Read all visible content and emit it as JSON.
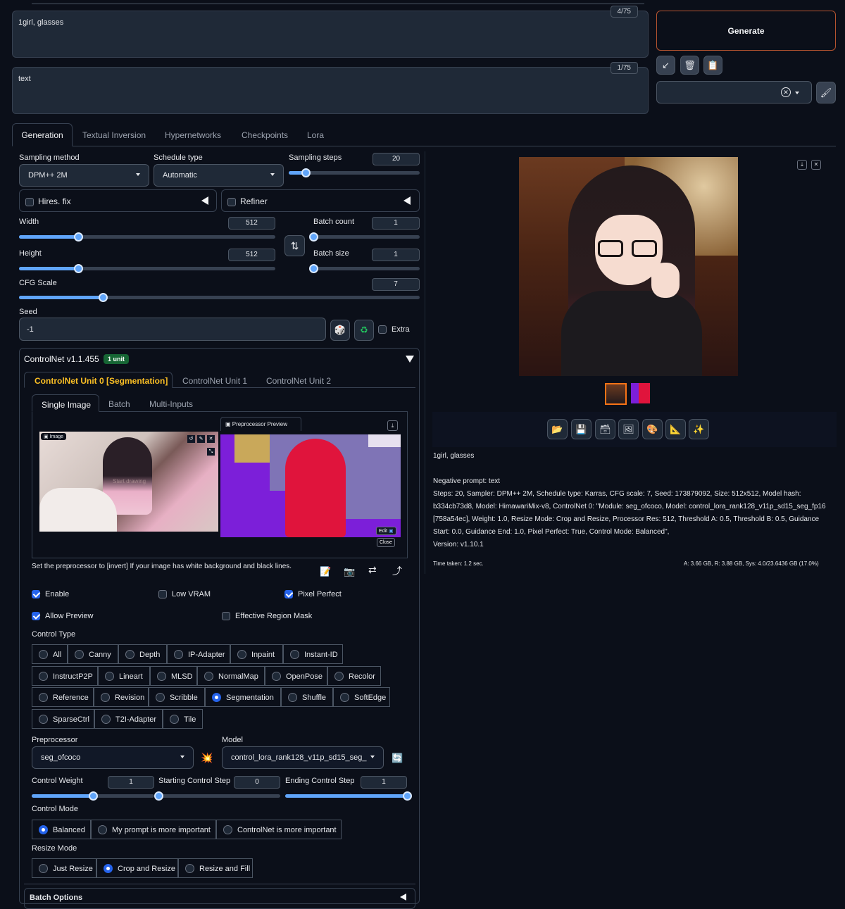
{
  "prompt": {
    "text": "1girl, glasses",
    "counter": "4/75"
  },
  "negative_prompt": {
    "text": "text",
    "counter": "1/75"
  },
  "generate_label": "Generate",
  "tabs": [
    "Generation",
    "Textual Inversion",
    "Hypernetworks",
    "Checkpoints",
    "Lora"
  ],
  "sampling": {
    "method_label": "Sampling method",
    "method_value": "DPM++ 2M",
    "schedule_label": "Schedule type",
    "schedule_value": "Automatic",
    "steps_label": "Sampling steps",
    "steps_value": "20",
    "steps_fraction": 0.13
  },
  "hires_label": "Hires. fix",
  "refiner_label": "Refiner",
  "width": {
    "label": "Width",
    "value": "512",
    "fraction": 0.23
  },
  "height": {
    "label": "Height",
    "value": "512",
    "fraction": 0.23
  },
  "batch_count": {
    "label": "Batch count",
    "value": "1",
    "fraction": 0.0
  },
  "batch_size": {
    "label": "Batch size",
    "value": "1",
    "fraction": 0.0
  },
  "cfg": {
    "label": "CFG Scale",
    "value": "7",
    "fraction": 0.21
  },
  "seed": {
    "label": "Seed",
    "value": "-1",
    "extra_label": "Extra"
  },
  "controlnet": {
    "title": "ControlNet v1.1.455",
    "badge": "1 unit",
    "unit_tabs": [
      "ControlNet Unit 0 [Segmentation]",
      "ControlNet Unit 1",
      "ControlNet Unit 2"
    ],
    "image_tabs": [
      "Single Image",
      "Batch",
      "Multi-Inputs"
    ],
    "image_label": "Image",
    "preview_label": "Preprocessor Preview",
    "watermark": "Start drawing",
    "edit_label": "Edit",
    "close_label": "Close",
    "hint": "Set the preprocessor to [invert] If your image has white background and black lines.",
    "checks": {
      "enable": "Enable",
      "low_vram": "Low VRAM",
      "pixel_perfect": "Pixel Perfect",
      "allow_preview": "Allow Preview",
      "effective_region_mask": "Effective Region Mask"
    },
    "control_type_label": "Control Type",
    "control_types": [
      [
        "All",
        "Canny",
        "Depth",
        "IP-Adapter",
        "Inpaint",
        "Instant-ID"
      ],
      [
        "InstructP2P",
        "Lineart",
        "MLSD",
        "NormalMap",
        "OpenPose",
        "Recolor"
      ],
      [
        "Reference",
        "Revision",
        "Scribble",
        "Segmentation",
        "Shuffle",
        "SoftEdge"
      ],
      [
        "SparseCtrl",
        "T2I-Adapter",
        "Tile"
      ]
    ],
    "selected_control_type": "Segmentation",
    "preprocessor_label": "Preprocessor",
    "preprocessor_value": "seg_ofcoco",
    "model_label": "Model",
    "model_value": "control_lora_rank128_v11p_sd15_seg_",
    "control_weight": {
      "label": "Control Weight",
      "value": "1",
      "fraction": 0.5
    },
    "start_step": {
      "label": "Starting Control Step",
      "value": "0",
      "fraction": 0.0
    },
    "end_step": {
      "label": "Ending Control Step",
      "value": "1",
      "fraction": 1.0
    },
    "control_mode_label": "Control Mode",
    "control_modes": [
      "Balanced",
      "My prompt is more important",
      "ControlNet is more important"
    ],
    "resize_mode_label": "Resize Mode",
    "resize_modes": [
      "Just Resize",
      "Crop and Resize",
      "Resize and Fill"
    ],
    "batch_options_label": "Batch Options"
  },
  "output": {
    "prompt": "1girl, glasses",
    "negative": "Negative prompt: text",
    "params": "Steps: 20, Sampler: DPM++ 2M, Schedule type: Karras, CFG scale: 7, Seed: 173879092, Size: 512x512, Model hash: b334cb73d8, Model: HimawariMix-v8, ControlNet 0: \"Module: seg_ofcoco, Model: control_lora_rank128_v11p_sd15_seg_fp16 [758a54ec], Weight: 1.0, Resize Mode: Crop and Resize, Processor Res: 512, Threshold A: 0.5, Threshold B: 0.5, Guidance Start: 0.0, Guidance End: 1.0, Pixel Perfect: True, Control Mode: Balanced\",",
    "version": "Version: v1.10.1",
    "time": "Time taken: 1.2 sec.",
    "vram": "A: 3.66 GB, R: 3.88 GB, Sys: 4.0/23.6436 GB (17.0%)"
  }
}
